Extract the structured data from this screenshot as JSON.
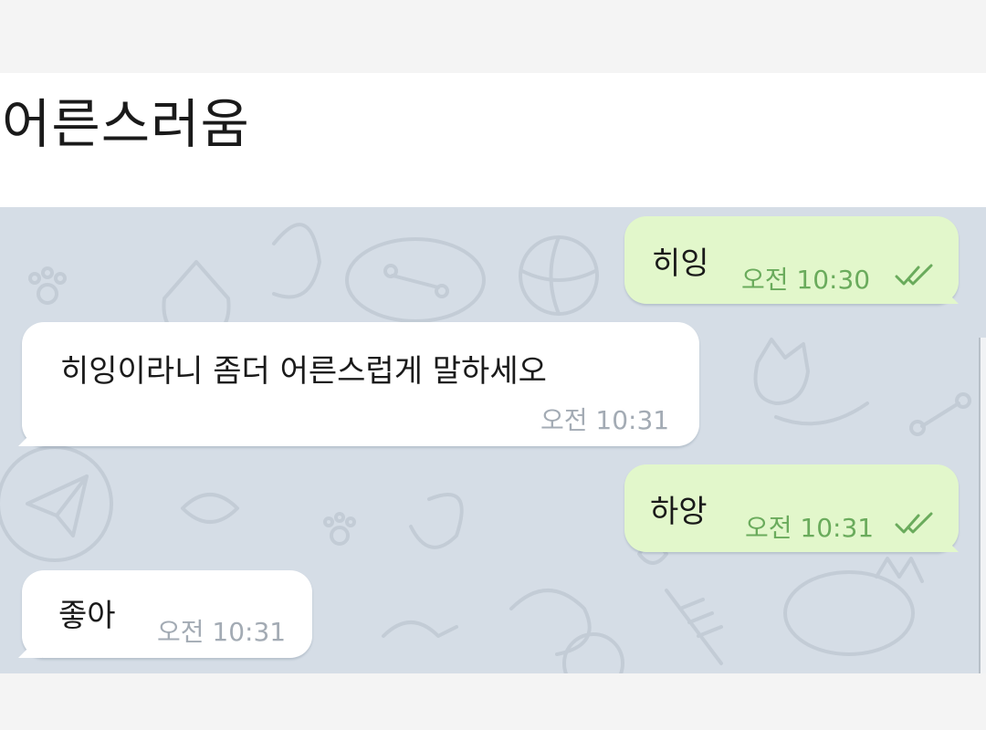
{
  "post": {
    "title": "어른스러움"
  },
  "chat": {
    "messages": [
      {
        "direction": "outgoing",
        "text": "히잉",
        "time": "오전 10:30",
        "status_icon": "double-check-icon"
      },
      {
        "direction": "incoming",
        "text": "히잉이라니 좀더 어른스럽게 말하세오",
        "time": "오전 10:31"
      },
      {
        "direction": "outgoing",
        "text": "하앙",
        "time": "오전 10:31",
        "status_icon": "double-check-icon"
      },
      {
        "direction": "incoming",
        "text": "좋아",
        "time": "오전 10:31"
      }
    ],
    "colors": {
      "background": "#d5dde6",
      "outgoing_bubble": "#e2f7cb",
      "incoming_bubble": "#ffffff",
      "outgoing_time": "#6aab5c",
      "incoming_time": "#a3abb4"
    }
  }
}
